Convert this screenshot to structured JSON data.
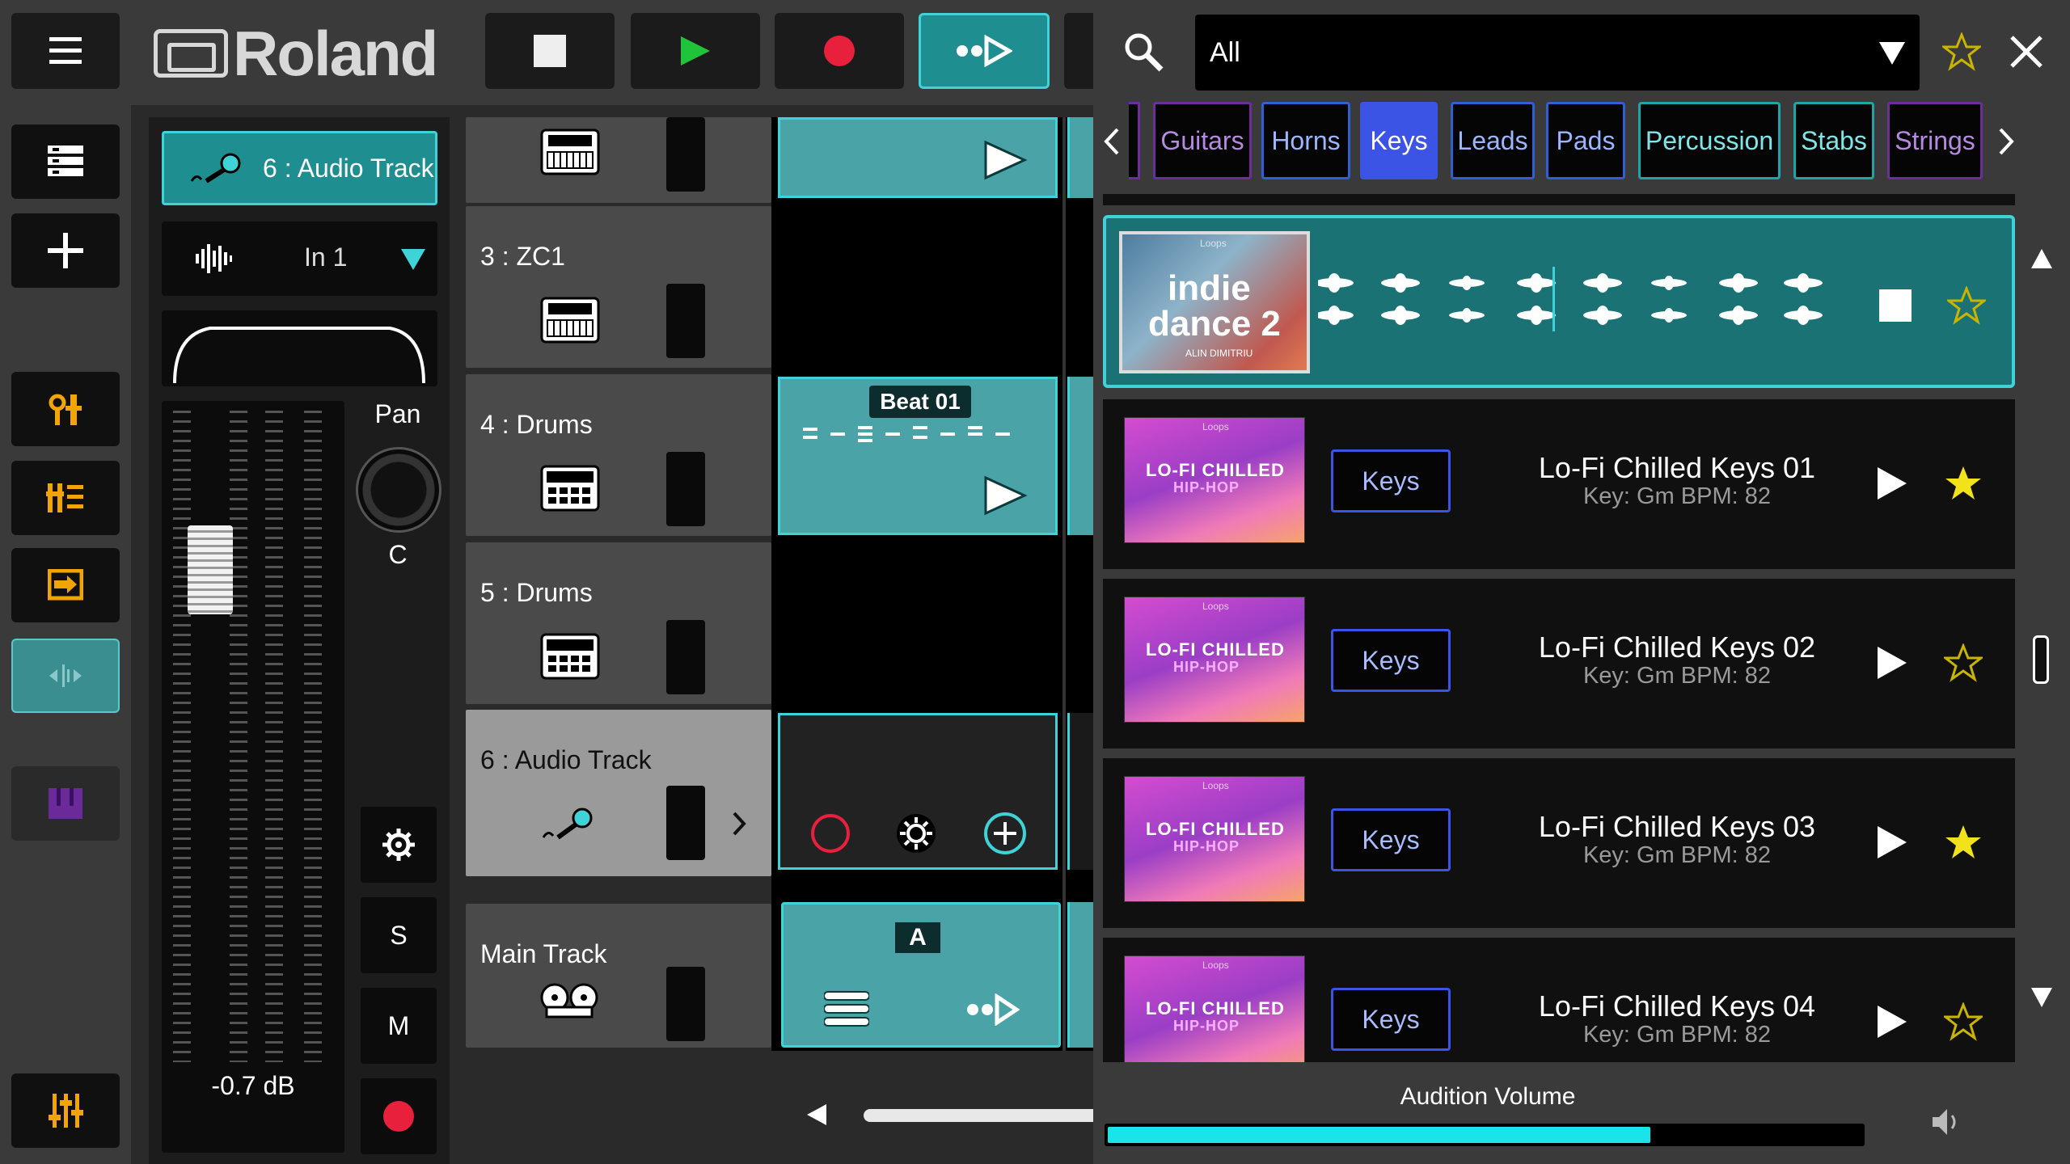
{
  "app": {
    "logo": "Roland"
  },
  "strip": {
    "track_label": "6 : Audio Track",
    "input_label": "In 1",
    "pan_label": "Pan",
    "pan_value": "C",
    "db_value": "-0.7 dB",
    "solo_label": "S",
    "mute_label": "M"
  },
  "tracks": [
    {
      "name": "3 : ZC1"
    },
    {
      "name": "4 : Drums"
    },
    {
      "name": "5 : Drums"
    },
    {
      "name": "6 : Audio Track"
    },
    {
      "name": "Main Track"
    }
  ],
  "clips": {
    "beat_label": "Beat 01",
    "scene_label": "A"
  },
  "browser": {
    "filter_value": "All",
    "tags": [
      "Guitars",
      "Horns",
      "Keys",
      "Leads",
      "Pads",
      "Percussion",
      "Stabs",
      "Strings"
    ],
    "active_tag": "Keys",
    "selected_item": {
      "thumb_line1": "indie",
      "thumb_line2": "dance 2",
      "thumb_credit": "ALIN DIMITRIU",
      "thumb_kind": "Loops"
    },
    "items": [
      {
        "title": "Lo-Fi Chilled Keys 01",
        "sub": "Key: Gm  BPM: 82",
        "tag": "Keys",
        "fav": true
      },
      {
        "title": "Lo-Fi Chilled Keys 02",
        "sub": "Key: Gm  BPM: 82",
        "tag": "Keys",
        "fav": false
      },
      {
        "title": "Lo-Fi Chilled Keys 03",
        "sub": "Key: Gm  BPM: 82",
        "tag": "Keys",
        "fav": true
      },
      {
        "title": "Lo-Fi Chilled Keys 04",
        "sub": "Key: Gm  BPM: 82",
        "tag": "Keys",
        "fav": false
      }
    ],
    "thumb_line1": "LO-FI CHILLED",
    "thumb_line2": "HIP-HOP",
    "thumb_kind": "Loops",
    "volume_label": "Audition Volume",
    "volume_level": 0.72
  },
  "colors": {
    "accent": "#3fd3d8",
    "teal": "#1e8e90",
    "record": "#e8203c",
    "play": "#1fc43a",
    "star": "#f2e21a"
  }
}
